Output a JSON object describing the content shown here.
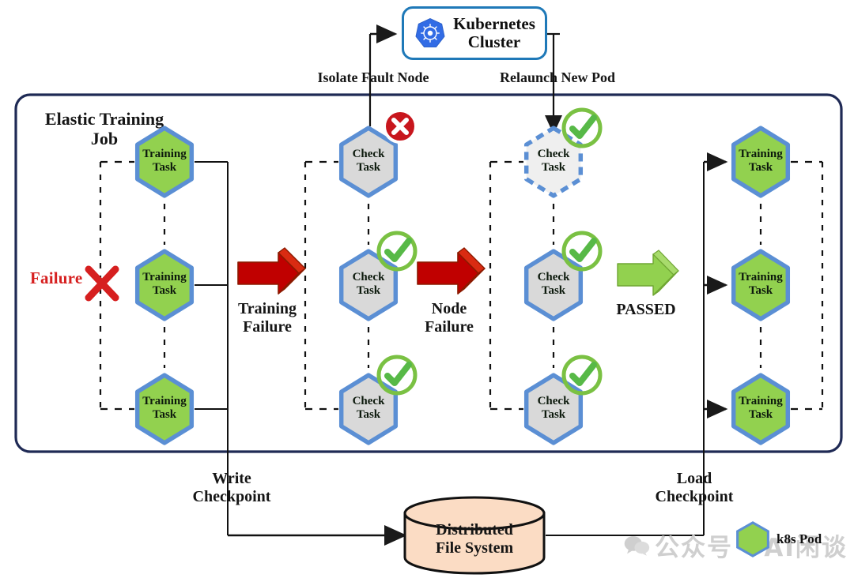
{
  "diagram": {
    "title": "Elastic Training Job fault tolerance flow",
    "container_label": "Elastic Training\nJob",
    "container_label_line1": "Elastic Training",
    "container_label_line2": "Job"
  },
  "colors": {
    "pod_green": "#92D14F",
    "hex_border_blue": "#5B8FD4",
    "check_gray": "#D9D9D9",
    "relaunch_gray": "#EFEFEF",
    "container_navy": "#1F2A55",
    "k8s_blue": "#326CE5",
    "k8s_border": "#1F79B8",
    "arrow_red": "#C00000",
    "arrow_green": "#92D14F",
    "failure_red": "#D61F1F",
    "badge_red": "#C8161D",
    "badge_green": "#7AC143",
    "dfs_fill": "#FBDCC4",
    "watermark_gray": "#CFCFCF"
  },
  "k8s": {
    "line1": "Kubernetes",
    "line2": "Cluster",
    "icon": "kubernetes-helm-icon"
  },
  "edge_labels": {
    "isolate": "Isolate Fault Node",
    "relaunch": "Relaunch New Pod",
    "write_checkpoint_line1": "Write",
    "write_checkpoint_line2": "Checkpoint",
    "load_checkpoint_line1": "Load",
    "load_checkpoint_line2": "Checkpoint"
  },
  "transitions": [
    {
      "name": "training-failure",
      "line1": "Training",
      "line2": "Failure",
      "color": "#C00000",
      "type": "red-block-arrow"
    },
    {
      "name": "node-failure",
      "line1": "Node",
      "line2": "Failure",
      "color": "#C00000",
      "type": "red-block-arrow"
    },
    {
      "name": "passed",
      "line1": "PASSED",
      "line2": "",
      "color": "#92D14F",
      "type": "green-block-arrow"
    }
  ],
  "columns": [
    {
      "name": "training-tasks-initial",
      "nodes": [
        {
          "label_line1": "Training",
          "label_line2": "Task",
          "style": "green",
          "badge": "none"
        },
        {
          "label_line1": "Training",
          "label_line2": "Task",
          "style": "green",
          "badge": "none"
        },
        {
          "label_line1": "Training",
          "label_line2": "Task",
          "style": "green",
          "badge": "none"
        }
      ]
    },
    {
      "name": "check-tasks-first-round",
      "nodes": [
        {
          "label_line1": "Check",
          "label_line2": "Task",
          "style": "gray",
          "badge": "fail"
        },
        {
          "label_line1": "Check",
          "label_line2": "Task",
          "style": "gray",
          "badge": "pass"
        },
        {
          "label_line1": "Check",
          "label_line2": "Task",
          "style": "gray",
          "badge": "pass"
        }
      ]
    },
    {
      "name": "check-tasks-second-round",
      "nodes": [
        {
          "label_line1": "Check",
          "label_line2": "Task",
          "style": "dashed",
          "badge": "pass"
        },
        {
          "label_line1": "Check",
          "label_line2": "Task",
          "style": "gray",
          "badge": "pass"
        },
        {
          "label_line1": "Check",
          "label_line2": "Task",
          "style": "gray",
          "badge": "pass"
        }
      ]
    },
    {
      "name": "training-tasks-resumed",
      "nodes": [
        {
          "label_line1": "Training",
          "label_line2": "Task",
          "style": "green",
          "badge": "none"
        },
        {
          "label_line1": "Training",
          "label_line2": "Task",
          "style": "green",
          "badge": "none"
        },
        {
          "label_line1": "Training",
          "label_line2": "Task",
          "style": "green",
          "badge": "none"
        }
      ]
    }
  ],
  "failure_marker": {
    "label": "Failure",
    "glyph": "x-mark-icon"
  },
  "storage": {
    "line1": "Distributed",
    "line2": "File System",
    "shape": "cylinder"
  },
  "legend": {
    "label": "k8s Pod",
    "swatch": "green-hexagon"
  },
  "watermark": {
    "text": "公众号 · AI闲谈",
    "icon": "wechat-icon"
  }
}
